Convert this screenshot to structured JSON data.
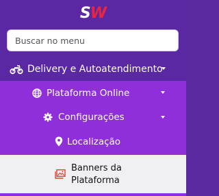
{
  "logo": {
    "s": "S",
    "w": "W"
  },
  "search": {
    "placeholder": "Buscar no menu"
  },
  "menu": {
    "delivery": {
      "label": "Delivery e Autoatendimento",
      "icon": "motorcycle-icon"
    },
    "submenu": [
      {
        "label": "Plataforma Online",
        "icon": "globe-icon",
        "has_caret": true
      },
      {
        "label": "Configurações",
        "icon": "gear-icon",
        "has_caret": true
      },
      {
        "label": "Localização",
        "icon": "map-marker-icon",
        "has_caret": false
      }
    ],
    "active": {
      "label": "Banners da Plataforma",
      "icon": "image-icon"
    }
  },
  "colors": {
    "sidebar_bg": "#5a28a3",
    "submenu_bg": "#8f2fd9",
    "active_bg": "#f0eff2",
    "logo_accent": "#e8253e",
    "active_icon": "#e0412f"
  }
}
